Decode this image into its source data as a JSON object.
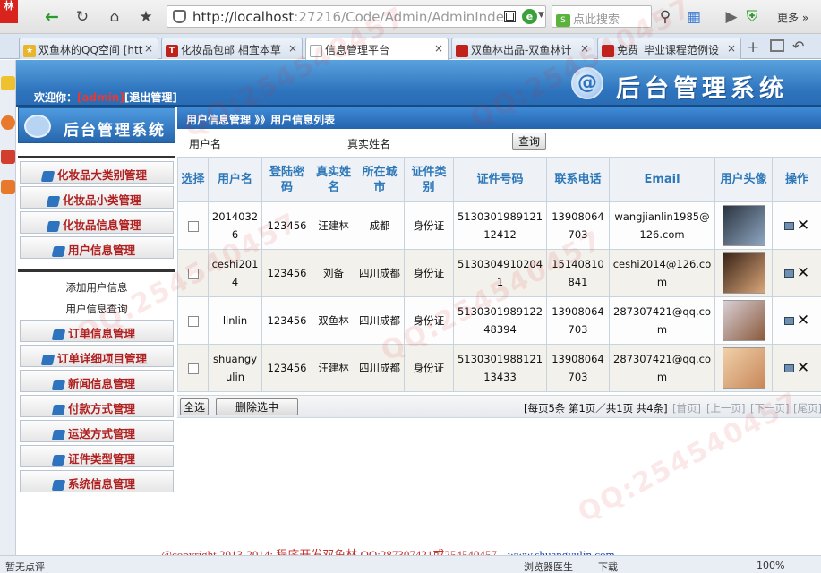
{
  "browser": {
    "app_badge": "林",
    "url_host": "http://localhost",
    "url_rest": ":27216/Code/Admin/AdminInde",
    "search_placeholder": "点此搜索",
    "more_label": "更多",
    "tabs": [
      {
        "label": "双鱼林的QQ空间 [htt",
        "icon_color": "#e8b52c"
      },
      {
        "label": "化妆品包邮 相宜本草",
        "icon_color": "#c0221b",
        "icon_letter": "T"
      },
      {
        "label": "信息管理平台",
        "icon_color": "#9aa6b2",
        "active": true
      },
      {
        "label": "双鱼林出品-双鱼林计",
        "icon_color": "#c0221b"
      },
      {
        "label": "免费_毕业课程范例设",
        "icon_color": "#c0221b"
      }
    ],
    "status_left": "暂无点评",
    "status_browser_doctor": "浏览器医生",
    "status_download": "下载",
    "status_zoom": "100%"
  },
  "header": {
    "welcome_prefix": "欢迎你：",
    "username": "[admin]",
    "logout": "[退出管理]",
    "title": "后台管理系统"
  },
  "sidebar": {
    "title": "后台管理系统",
    "menu_top": [
      "化妆品大类别管理",
      "化妆品小类管理",
      "化妆品信息管理",
      "用户信息管理"
    ],
    "submenu": [
      "添加用户信息",
      "用户信息查询"
    ],
    "menu_bottom": [
      "订单信息管理",
      "订单详细项目管理",
      "新闻信息管理",
      "付款方式管理",
      "运送方式管理",
      "证件类型管理",
      "系统信息管理"
    ]
  },
  "main": {
    "breadcrumb": "用户信息管理 》》用户信息列表",
    "search": {
      "username_label": "用户名",
      "username_value": "",
      "realname_label": "真实姓名",
      "realname_value": "",
      "query_button": "查询"
    },
    "table": {
      "headers": [
        "选择",
        "用户名",
        "登陆密码",
        "真实姓名",
        "所在城市",
        "证件类别",
        "证件号码",
        "联系电话",
        "Email",
        "用户头像",
        "操作"
      ],
      "rows": [
        {
          "username": "20140326",
          "password": "123456",
          "realname": "汪建林",
          "city": "成都",
          "id_type": "身份证",
          "id_number": "513030198912112412",
          "phone": "13908064703",
          "email": "wangjianlin1985@126.com",
          "avatar_colors": [
            "#2a3440",
            "#8fa7c2"
          ]
        },
        {
          "username": "ceshi2014",
          "password": "123456",
          "realname": "刘备",
          "city": "四川成都",
          "id_type": "身份证",
          "id_number": "51303049102041",
          "phone": "15140810841",
          "email": "ceshi2014@126.com",
          "avatar_colors": [
            "#3a2416",
            "#d9a67a"
          ]
        },
        {
          "username": "linlin",
          "password": "123456",
          "realname": "双鱼林",
          "city": "四川成都",
          "id_type": "身份证",
          "id_number": "513030198912248394",
          "phone": "13908064703",
          "email": "287307421@qq.com",
          "avatar_colors": [
            "#d8cfd6",
            "#8b5a3c"
          ]
        },
        {
          "username": "shuangyulin",
          "password": "123456",
          "realname": "汪建林",
          "city": "四川成都",
          "id_type": "身份证",
          "id_number": "513030198812113433",
          "phone": "13908064703",
          "email": "287307421@qq.com",
          "avatar_colors": [
            "#f0d0a8",
            "#c8875a"
          ]
        }
      ]
    },
    "footer": {
      "select_all": "全选",
      "delete_selected": "删除选中",
      "pagination": "[每页5条 第1页／共1页 共4条]",
      "first": "[首页]",
      "prev": "[上一页]",
      "next": "[下一页]",
      "last": "[尾页]"
    }
  },
  "copyright": {
    "text": "@copyright 2013-2014; 程序开发双鱼林  QQ:287307421或254540457",
    "site": "www.shuangyulin.com"
  }
}
